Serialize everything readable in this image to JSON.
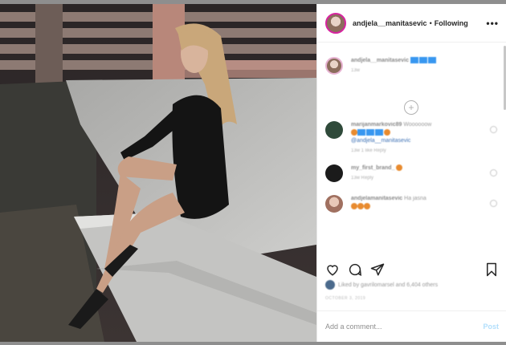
{
  "post": {
    "username": "andjela__manitasevic",
    "separator": "•",
    "follow_status": "Following",
    "more_icon": "more-horizontal-icon",
    "caption": {
      "user": "andjela__manitasevic",
      "time": "13w"
    },
    "comments": [
      {
        "user": "marijanmarkovic89",
        "text": "Woooooow",
        "meta": "13w   1 like   Reply"
      },
      {
        "user": "my_first_brand_",
        "text": "",
        "meta": "13w   Reply"
      },
      {
        "user": "andjelamanitasevic",
        "text": "Ha jasna",
        "meta": ""
      }
    ],
    "mention": "@andjela__manitasevic",
    "likes_text": "Liked by gavrilomarsel and 6,404 others",
    "date": "OCTOBER 3, 2019",
    "comment_placeholder": "Add a comment...",
    "post_button": "Post",
    "colors": {
      "link_blue": "#3897f0",
      "post_disabled": "#b2dffc",
      "story_ring": "#d6249f"
    }
  }
}
